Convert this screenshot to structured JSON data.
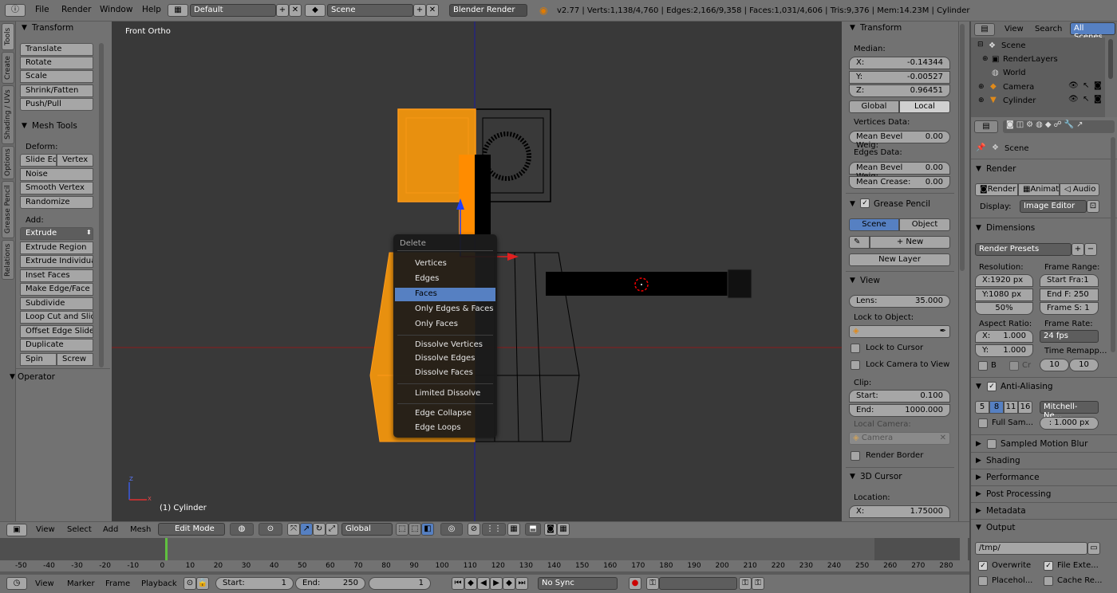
{
  "info_bar": {
    "menus": [
      "File",
      "Render",
      "Window",
      "Help"
    ],
    "layout": "Default",
    "scene": "Scene",
    "engine": "Blender Render",
    "stats": "v2.77 | Verts:1,138/4,760 | Edges:2,166/9,358 | Faces:1,031/4,606 | Tris:9,376 | Mem:14.23M | Cylinder"
  },
  "left_tabs": [
    "Tools",
    "Create",
    "Shading / UVs",
    "Options",
    "Grease Pencil",
    "Relations"
  ],
  "tool_shelf": {
    "transform": {
      "title": "Transform",
      "buttons": [
        "Translate",
        "Rotate",
        "Scale",
        "Shrink/Fatten",
        "Push/Pull"
      ]
    },
    "mesh_tools": {
      "title": "Mesh Tools",
      "deform_label": "Deform:",
      "slide_edge": "Slide Ed",
      "vertex": "Vertex",
      "noise": "Noise",
      "smooth_vertex": "Smooth Vertex",
      "randomize": "Randomize",
      "add_label": "Add:",
      "extrude": "Extrude",
      "add_buttons": [
        "Extrude Region",
        "Extrude Individual",
        "Inset Faces",
        "Make Edge/Face",
        "Subdivide",
        "Loop Cut and Slide",
        "Offset Edge Slide",
        "Duplicate"
      ],
      "spin": "Spin",
      "screw": "Screw"
    },
    "operator": "Operator"
  },
  "viewport": {
    "view_name": "Front Ortho",
    "object_label": "(1) Cylinder",
    "axis_z": "Z",
    "axis_x": "X"
  },
  "context_menu": {
    "title": "Delete",
    "groups": [
      [
        "Vertices",
        "Edges",
        "Faces",
        "Only Edges & Faces",
        "Only Faces"
      ],
      [
        "Dissolve Vertices",
        "Dissolve Edges",
        "Dissolve Faces"
      ],
      [
        "Limited Dissolve"
      ],
      [
        "Edge Collapse",
        "Edge Loops"
      ]
    ],
    "selected": "Faces"
  },
  "n_panel": {
    "transform": {
      "title": "Transform",
      "median_label": "Median:",
      "x": "-0.14344",
      "y": "-0.00527",
      "z": "0.96451",
      "global": "Global",
      "local": "Local",
      "vertices_data": "Vertices Data:",
      "mean_bevel_v": "0.00",
      "edges_data": "Edges Data:",
      "mean_bevel_e": "0.00",
      "mean_crease": "0.00",
      "mean_bevel_label": "Mean Bevel Weig:",
      "mean_crease_label": "Mean Crease:"
    },
    "grease_pencil": {
      "title": "Grease Pencil",
      "scene": "Scene",
      "object": "Object",
      "new": "New",
      "new_layer": "New Layer"
    },
    "view": {
      "title": "View",
      "lens_label": "Lens:",
      "lens": "35.000",
      "lock_object": "Lock to Object:",
      "lock_cursor": "Lock to Cursor",
      "lock_camera": "Lock Camera to View",
      "clip": "Clip:",
      "start_label": "Start:",
      "start": "0.100",
      "end_label": "End:",
      "end": "1000.000",
      "local_camera": "Local Camera:",
      "camera": "Camera",
      "render_border": "Render Border"
    },
    "cursor": {
      "title": "3D Cursor",
      "location": "Location:",
      "x_label": "X:",
      "x": "1.75000"
    }
  },
  "outliner": {
    "view": "View",
    "search": "Search",
    "all_scenes": "All Scenes",
    "items": [
      "Scene",
      "RenderLayers",
      "World",
      "Camera",
      "Cylinder"
    ]
  },
  "properties": {
    "scene": "Scene",
    "render": {
      "title": "Render",
      "render_btn": "Render",
      "anim_btn": "Animati",
      "audio_btn": "Audio",
      "display_label": "Display:",
      "display": "Image Editor"
    },
    "dimensions": {
      "title": "Dimensions",
      "presets": "Render Presets",
      "resolution": "Resolution:",
      "res_x": "X:1920 px",
      "res_y": "Y:1080 px",
      "percent": "50%",
      "frame_range": "Frame Range:",
      "start": "Start Fra:1",
      "end": "End F: 250",
      "step": "Frame S: 1",
      "aspect": "Aspect Ratio:",
      "asp_x": "1.000",
      "asp_y": "1.000",
      "frame_rate": "Frame Rate:",
      "fps": "24 fps",
      "time_remap": "Time Remapp...",
      "remap_a": "10",
      "remap_b": "10",
      "b": "B",
      "cr": "Cr"
    },
    "aa": {
      "title": "Anti-Aliasing",
      "samples": [
        "5",
        "8",
        "11",
        "16"
      ],
      "filter": "Mitchell-Ne...",
      "full_sample": "Full Sam...",
      "filter_size": ": 1.000 px"
    },
    "sections": [
      "Sampled Motion Blur",
      "Shading",
      "Performance",
      "Post Processing",
      "Metadata",
      "Output"
    ],
    "output": {
      "path": "/tmp/",
      "overwrite": "Overwrite",
      "file_ext": "File Exte...",
      "placeholders": "Placehol...",
      "cache": "Cache Re..."
    }
  },
  "view3d_header": {
    "view": "View",
    "select": "Select",
    "add": "Add",
    "mesh": "Mesh",
    "mode": "Edit Mode",
    "orientation": "Global"
  },
  "timeline": {
    "ticks": [
      "-50",
      "-40",
      "-30",
      "-20",
      "-10",
      "0",
      "10",
      "20",
      "30",
      "40",
      "50",
      "60",
      "70",
      "80",
      "90",
      "100",
      "110",
      "120",
      "130",
      "140",
      "150",
      "160",
      "170",
      "180",
      "190",
      "200",
      "210",
      "220",
      "230",
      "240",
      "250",
      "260",
      "270",
      "280"
    ],
    "view": "View",
    "marker": "Marker",
    "frame": "Frame",
    "playback": "Playback",
    "start_label": "Start:",
    "start": "1",
    "end_label": "End:",
    "end": "250",
    "current": "1",
    "sync": "No Sync"
  },
  "colors": {
    "selected": "#ff8c00",
    "highlight": "#5680c2",
    "viewport": "#393939"
  }
}
